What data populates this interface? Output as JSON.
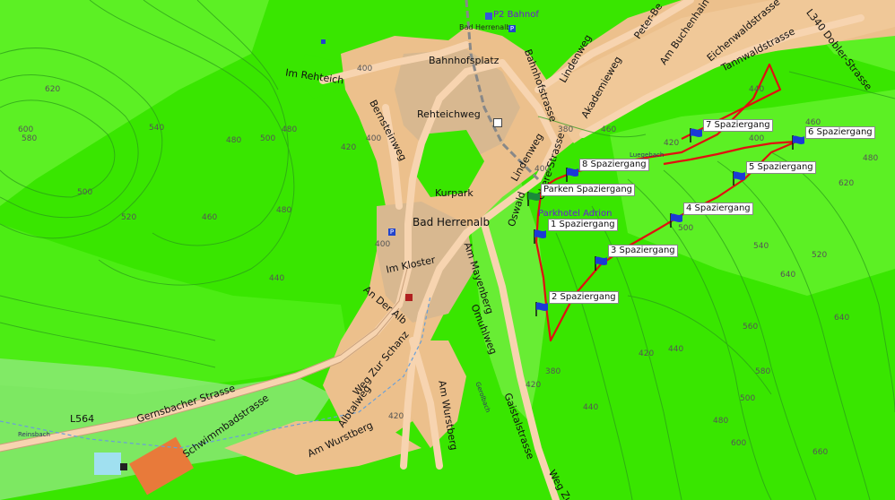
{
  "map": {
    "town": "Bad Herrenalb",
    "streets": {
      "im_rehteich": "Im Rehteich",
      "bahnhofsplatz": "Bahnhofsplatz",
      "rehteichweg": "Rehteichweg",
      "bernsteinweg": "Bernsteinweg",
      "bahnhofstrasse": "Bahnhofstrasse",
      "lindenweg_top": "Lindenweg",
      "lindenweg_mid": "Lindenweg",
      "akademieweg": "Akademieweg",
      "peter_be": "Peter-Be",
      "am_buchenhain": "Am Buchenhain",
      "eichenwaldstrasse": "Eichenwaldstrasse",
      "tannwaldstrasse": "Tannwaldstrasse",
      "l340": "L340 Dobler-Strasse",
      "kurpark": "Kurpark",
      "oswald": "Oswald",
      "obere_strasse": "Obere-Strasse",
      "im_kloster": "Im Kloster",
      "am_mayenberg": "Am Mayenberg",
      "an_der_alb": "An Der Alb",
      "omuhlweg": "Omuhlweg",
      "weg_zur_schanz": "Weg Zur Schanz",
      "albtalweg": "Albtalweg",
      "am_wurstberg_1": "Am Wurstberg",
      "am_wurstberg_2": "Am Wurstberg",
      "gaistalstrasse": "Gaistalstrasse",
      "gernsbacher": "Gernsbacher Strasse",
      "schwimmbadstrasse": "Schwimmbadstrasse",
      "l564": "L564",
      "weg_zu": "Weg Zu",
      "bad_herrenalb_station": "Bad Herrenalb",
      "p2_bahnhof": "P2 Bahnof",
      "parkhotel": "Parkhotel Adrion",
      "gerolbach": "Gerolbach",
      "reinsbach": "Reinsbach",
      "luegebach": "Luegebach"
    },
    "waypoints": [
      {
        "id": "wp1",
        "label": "1 Spaziergang"
      },
      {
        "id": "wp2",
        "label": "2 Spaziergang"
      },
      {
        "id": "wp3",
        "label": "3 Spaziergang"
      },
      {
        "id": "wp4",
        "label": "4 Spaziergang"
      },
      {
        "id": "wp5",
        "label": "5 Spaziergang"
      },
      {
        "id": "wp6",
        "label": "6 Spaziergang"
      },
      {
        "id": "wp7",
        "label": "7 Spaziergang"
      },
      {
        "id": "wp8",
        "label": "8 Spaziergang"
      },
      {
        "id": "parken",
        "label": "Parken Spaziergang"
      }
    ],
    "contours": [
      "620",
      "580",
      "600",
      "520",
      "500",
      "480",
      "460",
      "540",
      "500",
      "480",
      "440",
      "400",
      "420",
      "400",
      "380",
      "480",
      "420",
      "460",
      "440",
      "400",
      "460",
      "480",
      "400",
      "400",
      "420",
      "380",
      "420",
      "440",
      "500",
      "420",
      "440",
      "480",
      "500",
      "520",
      "540",
      "560",
      "580",
      "600",
      "620",
      "640",
      "660",
      "640",
      "560",
      "520",
      "600",
      "400",
      "420",
      "440",
      "460",
      "480"
    ],
    "colors": {
      "forest": "#39e600",
      "forest_light": "#66ff33",
      "residential": "#e8b27a",
      "town_center": "#d9b48a",
      "road": "#f5c8a0",
      "route": "#e01010",
      "flag": "#1a3ad6"
    }
  }
}
